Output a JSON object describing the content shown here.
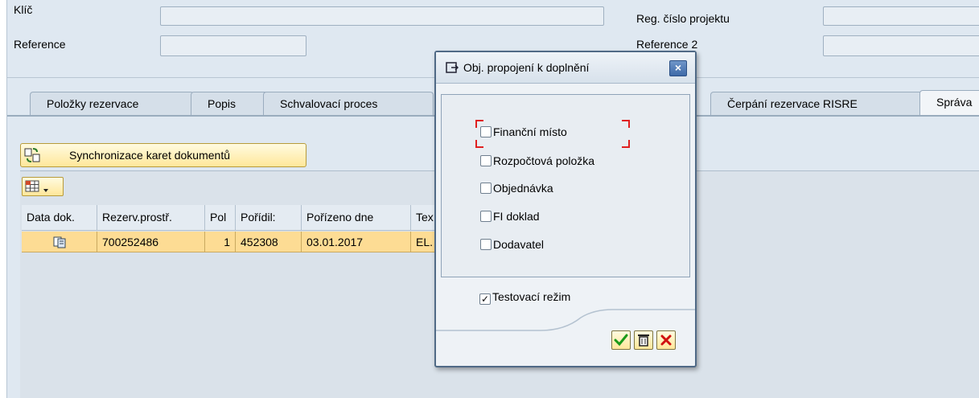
{
  "header": {
    "key_label": "Klíč",
    "reference_label": "Reference",
    "project_reg_label": "Reg. číslo projektu",
    "reference2_label": "Reference 2"
  },
  "tabs": [
    {
      "label": "Položky rezervace"
    },
    {
      "label": "Popis"
    },
    {
      "label": "Schvalovací proces"
    },
    {
      "label": "Čerpání rezervace RISRE"
    },
    {
      "label": "Správa"
    }
  ],
  "toolbar": {
    "sync_label": "Synchronizace karet dokumentů"
  },
  "table": {
    "columns": [
      "Data dok.",
      "Rezerv.prostř.",
      "Pol",
      "Pořídil:",
      "Pořízeno dne",
      "Tex"
    ],
    "rows": [
      {
        "doc_number": "700252486",
        "item": "1",
        "created_by": "452308",
        "created_on": "03.01.2017",
        "text": "EL."
      }
    ]
  },
  "dialog": {
    "title": "Obj. propojení k doplnění",
    "options": [
      {
        "label": "Finanční místo",
        "checked": false
      },
      {
        "label": "Rozpočtová položka",
        "checked": false
      },
      {
        "label": "Objednávka",
        "checked": false
      },
      {
        "label": "FI doklad",
        "checked": false
      },
      {
        "label": "Dodavatel",
        "checked": false
      }
    ],
    "test_mode": {
      "label": "Testovací režim",
      "checked": true
    }
  },
  "colors": {
    "accent": "#3e6aa8",
    "row_highlight": "#fddc94",
    "confirm": "#1a9a1a",
    "cancel": "#d01010"
  }
}
